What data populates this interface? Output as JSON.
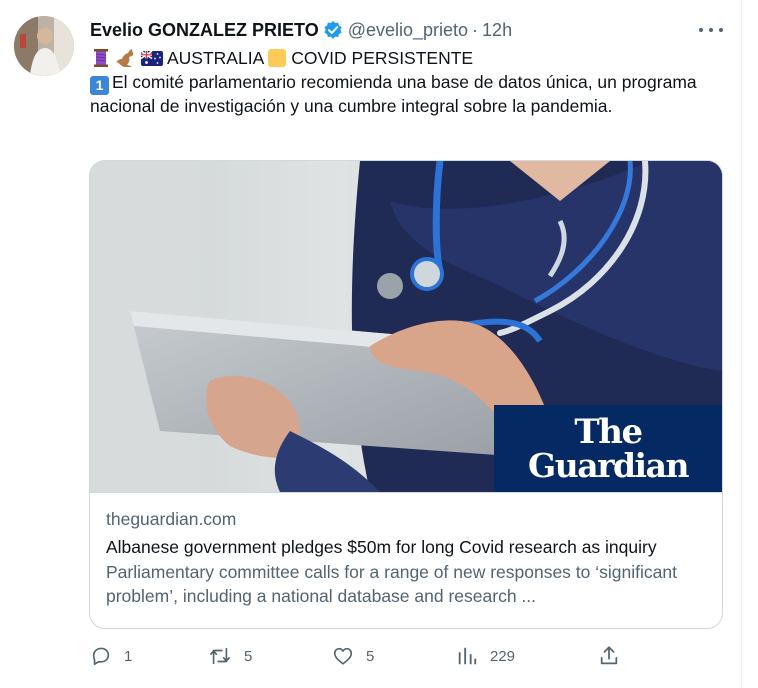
{
  "tweet": {
    "author_name": "Evelio GONZALEZ PRIETO",
    "handle": "@evelio_prieto",
    "separator": "·",
    "time": "12h",
    "line1_text1": "AUSTRALIA",
    "line1_text2": "COVID PERSISTENTE",
    "number_badge": "1",
    "body": "El comité parlamentario recomienda una base de datos única, un programa nacional de investigación y una cumbre integral sobre la pandemia."
  },
  "card": {
    "logo_line1": "The",
    "logo_line2": "Guardian",
    "domain": "theguardian.com",
    "title": "Albanese government pledges $50m for long Covid research as inquiry",
    "description": "Parliamentary committee calls for a range of new responses to ‘significant problem’, including a national database and research ..."
  },
  "actions": {
    "replies": "1",
    "retweets": "5",
    "likes": "5",
    "views": "229"
  },
  "icons": [
    "verified-badge-icon",
    "thread-icon",
    "kangaroo-icon",
    "australia-flag-icon",
    "yellow-square-icon",
    "more-icon",
    "reply-icon",
    "retweet-icon",
    "like-icon",
    "views-icon",
    "share-icon"
  ],
  "colors": {
    "accent": "#1d9bf0",
    "secondary_text": "#536471",
    "guardian_blue": "#052962"
  }
}
